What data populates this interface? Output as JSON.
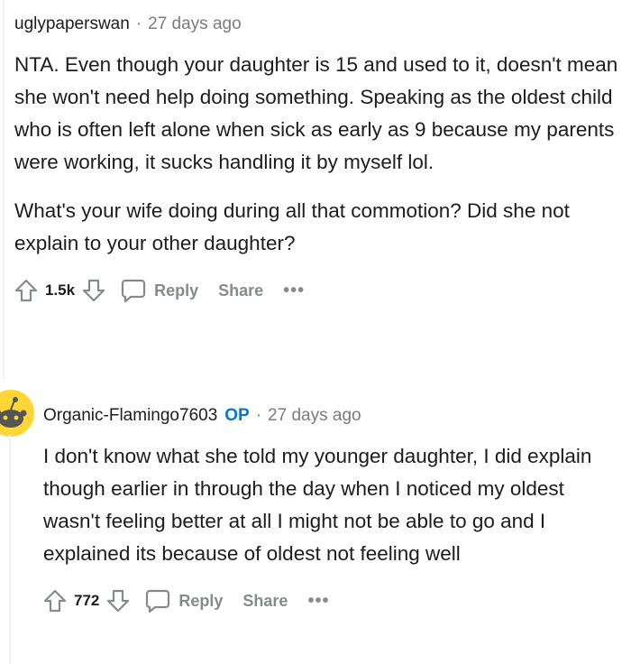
{
  "comments": [
    {
      "author": "uglypaperswan",
      "is_op": false,
      "time": "27 days ago",
      "paragraphs": [
        "NTA. Even though your daughter is 15 and used to it, doesn't mean she won't need help doing something. Speaking as the oldest child who is often left alone when sick as early as 9 because my parents were working, it sucks handling it by myself lol.",
        "What's your wife doing during all that commotion? Did she not explain to your other daughter?"
      ],
      "score": "1.5k",
      "reply_label": "Reply",
      "share_label": "Share",
      "more_label": "•••"
    },
    {
      "author": "Organic-Flamingo7603",
      "op_badge": "OP",
      "time": "27 days ago",
      "paragraphs": [
        "I don't know what she told my younger daughter, I did explain though earlier in through the day when I noticed my oldest wasn't feeling better at all I might not be able to go and I explained its because of oldest not feeling well"
      ],
      "score": "772",
      "reply_label": "Reply",
      "share_label": "Share",
      "more_label": "•••"
    }
  ],
  "colors": {
    "op_badge": "#0079d3",
    "meta_gray": "#7c7c7c",
    "action_gray": "#878a8c",
    "avatar_bg": "#ffd635"
  },
  "icons": [
    "upvote-icon",
    "downvote-icon",
    "reply-icon",
    "snoo-avatar-icon"
  ]
}
